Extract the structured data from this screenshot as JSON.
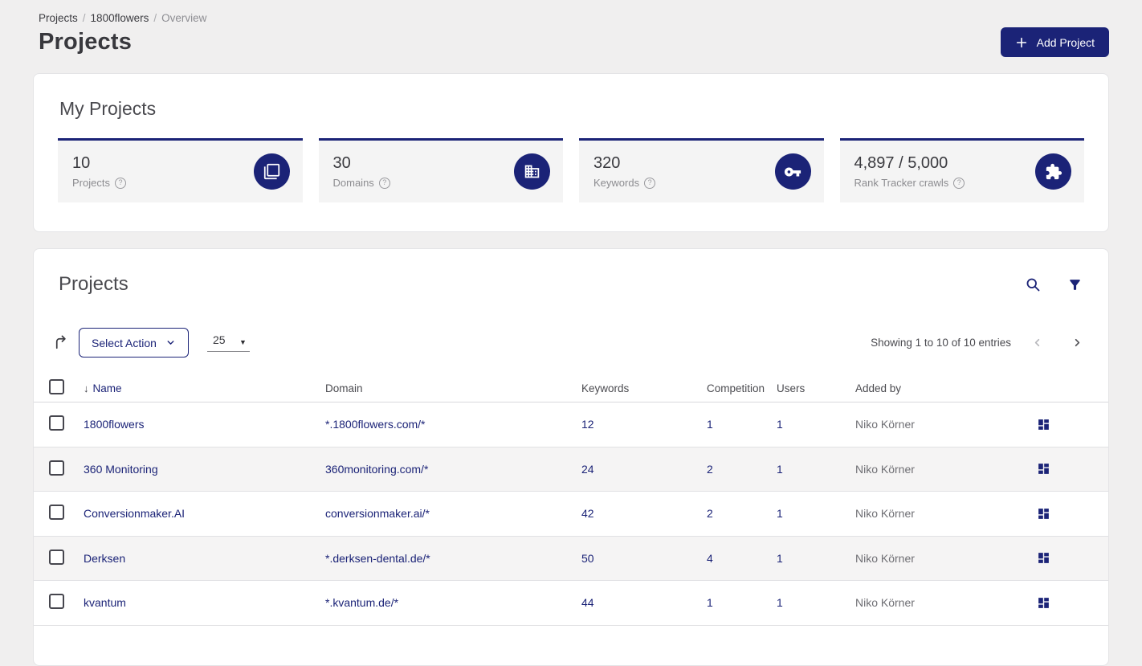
{
  "colors": {
    "primary": "#1b2377",
    "page_bg": "#f0efef"
  },
  "breadcrumb": {
    "separator": "/",
    "items": [
      {
        "label": "Projects"
      },
      {
        "label": "1800flowers"
      },
      {
        "label": "Overview"
      }
    ]
  },
  "page_title": "Projects",
  "add_project": {
    "label": "Add Project"
  },
  "my_projects": {
    "title": "My Projects",
    "stats": [
      {
        "value": "10",
        "label": "Projects",
        "icon": "copy-squares-icon"
      },
      {
        "value": "30",
        "label": "Domains",
        "icon": "building-icon"
      },
      {
        "value": "320",
        "label": "Keywords",
        "icon": "key-icon"
      },
      {
        "value": "4,897 / 5,000",
        "label": "Rank Tracker crawls",
        "icon": "puzzle-icon"
      }
    ]
  },
  "projects": {
    "title": "Projects",
    "toolbar": {
      "select_action_label": "Select Action",
      "page_size": "25",
      "showing_text": "Showing 1 to 10 of 10 entries"
    },
    "columns": {
      "name": "Name",
      "domain": "Domain",
      "keywords": "Keywords",
      "competition": "Competition",
      "users": "Users",
      "added_by": "Added by"
    },
    "sort_arrow": "↓",
    "rows": [
      {
        "name": "1800flowers",
        "domain": "*.1800flowers.com/*",
        "keywords": "12",
        "competition": "1",
        "users": "1",
        "added_by": "Niko Körner"
      },
      {
        "name": "360 Monitoring",
        "domain": "360monitoring.com/*",
        "keywords": "24",
        "competition": "2",
        "users": "1",
        "added_by": "Niko Körner"
      },
      {
        "name": "Conversionmaker.AI",
        "domain": "conversionmaker.ai/*",
        "keywords": "42",
        "competition": "2",
        "users": "1",
        "added_by": "Niko Körner"
      },
      {
        "name": "Derksen",
        "domain": "*.derksen-dental.de/*",
        "keywords": "50",
        "competition": "4",
        "users": "1",
        "added_by": "Niko Körner"
      },
      {
        "name": "kvantum",
        "domain": "*.kvantum.de/*",
        "keywords": "44",
        "competition": "1",
        "users": "1",
        "added_by": "Niko Körner"
      }
    ]
  },
  "help_glyph": "?"
}
